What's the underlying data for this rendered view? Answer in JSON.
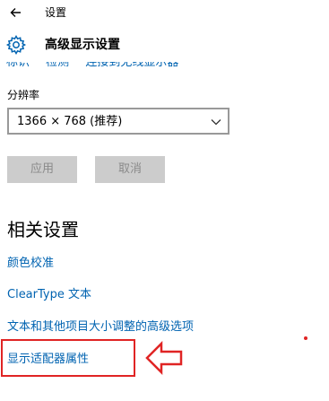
{
  "titlebar": {
    "title": "设置"
  },
  "header": {
    "title": "高级显示设置"
  },
  "top_links": [
    "标识",
    "检测",
    "连接到无线显示器"
  ],
  "resolution": {
    "label": "分辨率",
    "selected": "1366 × 768 (推荐)"
  },
  "buttons": {
    "apply": "应用",
    "cancel": "取消"
  },
  "related": {
    "heading": "相关设置",
    "links": [
      "颜色校准",
      "ClearType 文本",
      "文本和其他项目大小调整的高级选项",
      "显示适配器属性"
    ]
  },
  "colors": {
    "link": "#0063b1",
    "annotation": "#e02424",
    "button_bg": "#cccccc"
  }
}
